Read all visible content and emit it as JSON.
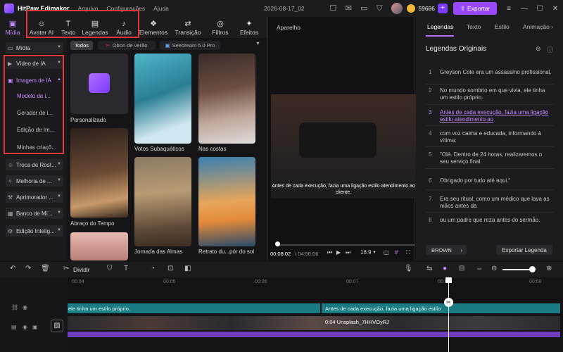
{
  "app": {
    "name": "HitPaw Edimakor",
    "menu": [
      "Arquivo",
      "Configurações",
      "Ajuda"
    ],
    "document_title": "2026-08-17_02",
    "credits": "59686",
    "export_label": "Exportar"
  },
  "toolbar": {
    "items": [
      {
        "label": "Mídia",
        "icon": "media-icon"
      },
      {
        "label": "Avatar AI",
        "icon": "avatar-icon"
      },
      {
        "label": "Texto",
        "icon": "text-icon"
      },
      {
        "label": "Legendas",
        "icon": "captions-icon"
      },
      {
        "label": "Áudio",
        "icon": "audio-icon"
      },
      {
        "label": "Elementos",
        "icon": "elements-icon"
      },
      {
        "label": "Transição",
        "icon": "transition-icon"
      },
      {
        "label": "Filtros",
        "icon": "filters-icon"
      },
      {
        "label": "Efeitos",
        "icon": "effects-icon"
      }
    ]
  },
  "sidebar": {
    "items": [
      {
        "label": "Mídia"
      },
      {
        "label": "Vídeo de IA"
      },
      {
        "label": "Imagem de IA"
      },
      {
        "label": "Troca de Rost..."
      },
      {
        "label": "Melhoria de ..."
      },
      {
        "label": "Aprimorador ..."
      },
      {
        "label": "Banco de Mí..."
      },
      {
        "label": "Edição Intelig..."
      }
    ],
    "subitems": [
      "Modelo de i...",
      "Gerador de i...",
      "Edição de Im...",
      "Minhas criaçõ..."
    ]
  },
  "media": {
    "filters": [
      "Todos",
      "Obon de verão",
      "Seedream 5.0 Pro"
    ],
    "cards": [
      {
        "label": "Personalizado"
      },
      {
        "label": "Votos Subaquáticos"
      },
      {
        "label": "Nas costas"
      },
      {
        "label": "Abraço do Tempo"
      },
      {
        "label": "Jornada das Almas"
      },
      {
        "label": "Retrato du...pór do sol"
      }
    ]
  },
  "player": {
    "title": "Aparelho",
    "subtitle": "Antes de cada execução, fazia uma ligação estilo atendimento ao cliente.",
    "time_current": "00:08:02",
    "time_total": "/ 04:56:06",
    "aspect": "16:9"
  },
  "right_panel": {
    "tabs": [
      "Legendas",
      "Texto",
      "Estilo",
      "Animação"
    ],
    "title": "Legendas Originais",
    "subtitles": [
      {
        "num": "1",
        "text": "Greyson Cole era um assassino profissional."
      },
      {
        "num": "2",
        "text": "No mundo sombrio em que vivia, ele tinha um estilo próprio."
      },
      {
        "num": "3",
        "text": "Antes de cada execução, fazia uma ligação estilo atendimento ao"
      },
      {
        "num": "4",
        "text": "com voz calma e educada, informando à vítima:"
      },
      {
        "num": "5",
        "text": "\"Olá. Dentro de 24 horas, realizaremos o seu serviço final."
      },
      {
        "num": "6",
        "text": "Obrigado por tudo até aqui.\""
      },
      {
        "num": "7",
        "text": "Era seu ritual, como um médico que lava as mãos antes da"
      },
      {
        "num": "8",
        "text": "ou um padre que reza antes do sermão."
      }
    ],
    "active_index": 3,
    "brown_label": "BROWN",
    "export_label": "Exportar Legenda"
  },
  "timeline": {
    "split_label": "Dividir",
    "ruler": [
      "00:04",
      "00:05",
      "00:06",
      "00:07",
      "00:08",
      "00:09"
    ],
    "subtitle_clip_a": "ele tinha um estilo próprio.",
    "subtitle_clip_b": "Antes de cada execução, fazia uma ligação estilo atendimento ao cliente.",
    "video_clip_label": "0:04  Unsplash_7HHVOyRJ"
  }
}
